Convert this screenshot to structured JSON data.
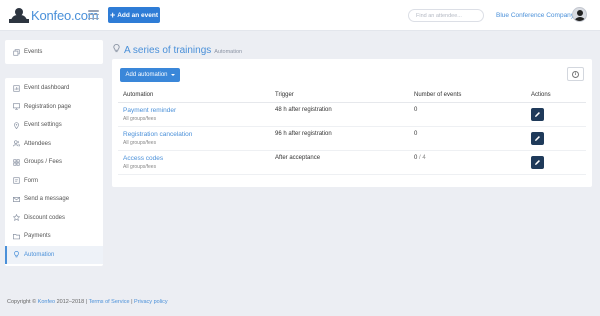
{
  "header": {
    "logo_text": "Konfeo.com",
    "add_event_label": "Add an event",
    "search_placeholder": "Find an attendee...",
    "company": "Blue Conference Company"
  },
  "sidebar": {
    "top_item": {
      "label": "Events",
      "icon": "copy-icon"
    },
    "items": [
      {
        "label": "Event dashboard",
        "icon": "dashboard-icon"
      },
      {
        "label": "Registration page",
        "icon": "monitor-icon"
      },
      {
        "label": "Event settings",
        "icon": "location-pin-icon"
      },
      {
        "label": "Attendees",
        "icon": "users-icon"
      },
      {
        "label": "Groups / Fees",
        "icon": "groups-icon"
      },
      {
        "label": "Form",
        "icon": "form-icon"
      },
      {
        "label": "Send a message",
        "icon": "envelope-icon"
      },
      {
        "label": "Discount codes",
        "icon": "star-icon"
      },
      {
        "label": "Payments",
        "icon": "folder-icon"
      },
      {
        "label": "Automation",
        "icon": "lightbulb-icon",
        "active": true
      }
    ]
  },
  "main": {
    "title": "A series of trainings",
    "subtitle": "Automation",
    "add_automation_label": "Add automation",
    "table": {
      "headers": [
        "Automation",
        "Trigger",
        "Number of events",
        "Actions"
      ],
      "rows": [
        {
          "name": "Payment reminder",
          "sub": "All groups/fees",
          "trigger": "48 h after registration",
          "count": "0",
          "total": ""
        },
        {
          "name": "Registration cancelation",
          "sub": "All groups/fees",
          "trigger": "96 h after registration",
          "count": "0",
          "total": ""
        },
        {
          "name": "Access codes",
          "sub": "All groups/fees",
          "trigger": "After acceptance",
          "count": "0",
          "total": "/ 4"
        }
      ]
    }
  },
  "footer": {
    "copyright": "Copyright ©",
    "brand": "Konfeo",
    "years": "2012–2018 |",
    "terms": "Terms of Service",
    "sep": "|",
    "privacy": "Privacy policy"
  },
  "colors": {
    "accent": "#4a90d9",
    "primary_button": "#2e7cd6",
    "edit_button": "#1f3a5a",
    "background": "#eceef3"
  }
}
